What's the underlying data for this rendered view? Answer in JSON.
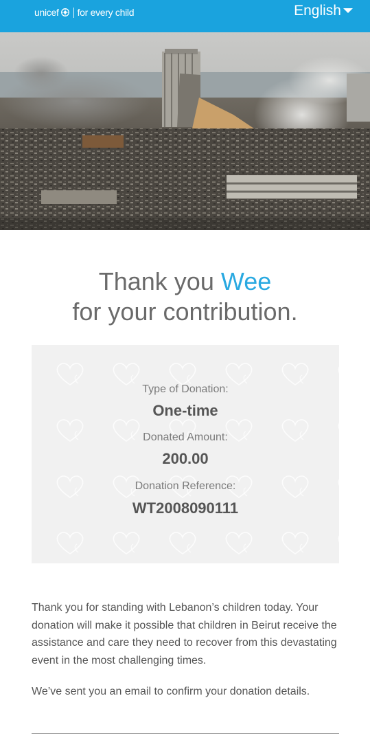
{
  "header": {
    "logo_brand": "unicef",
    "logo_tagline": "for every child",
    "language": "English"
  },
  "hero": {
    "icon": "beirut-port-explosion-photo"
  },
  "thanks": {
    "line1": "Thank you",
    "donor_name": "Wee",
    "line2": "for your contribution."
  },
  "summary": {
    "type_label": "Type of Donation:",
    "type_value": "One-time",
    "amount_label": "Donated Amount:",
    "amount_value": "200.00",
    "reference_label": "Donation Reference:",
    "reference_value": "WT2008090111"
  },
  "message": {
    "paragraph1": "Thank you for standing with Lebanon’s children today. Your donation will make it possible that children in Beirut receive the assistance and care they need to recover from this devastating event in the most challenging times.",
    "paragraph2": "We’ve sent you an email to confirm your donation details."
  },
  "colors": {
    "header_bg": "#1aa3de",
    "accent": "#29a9e1",
    "summary_bg": "#f1f1f1"
  }
}
